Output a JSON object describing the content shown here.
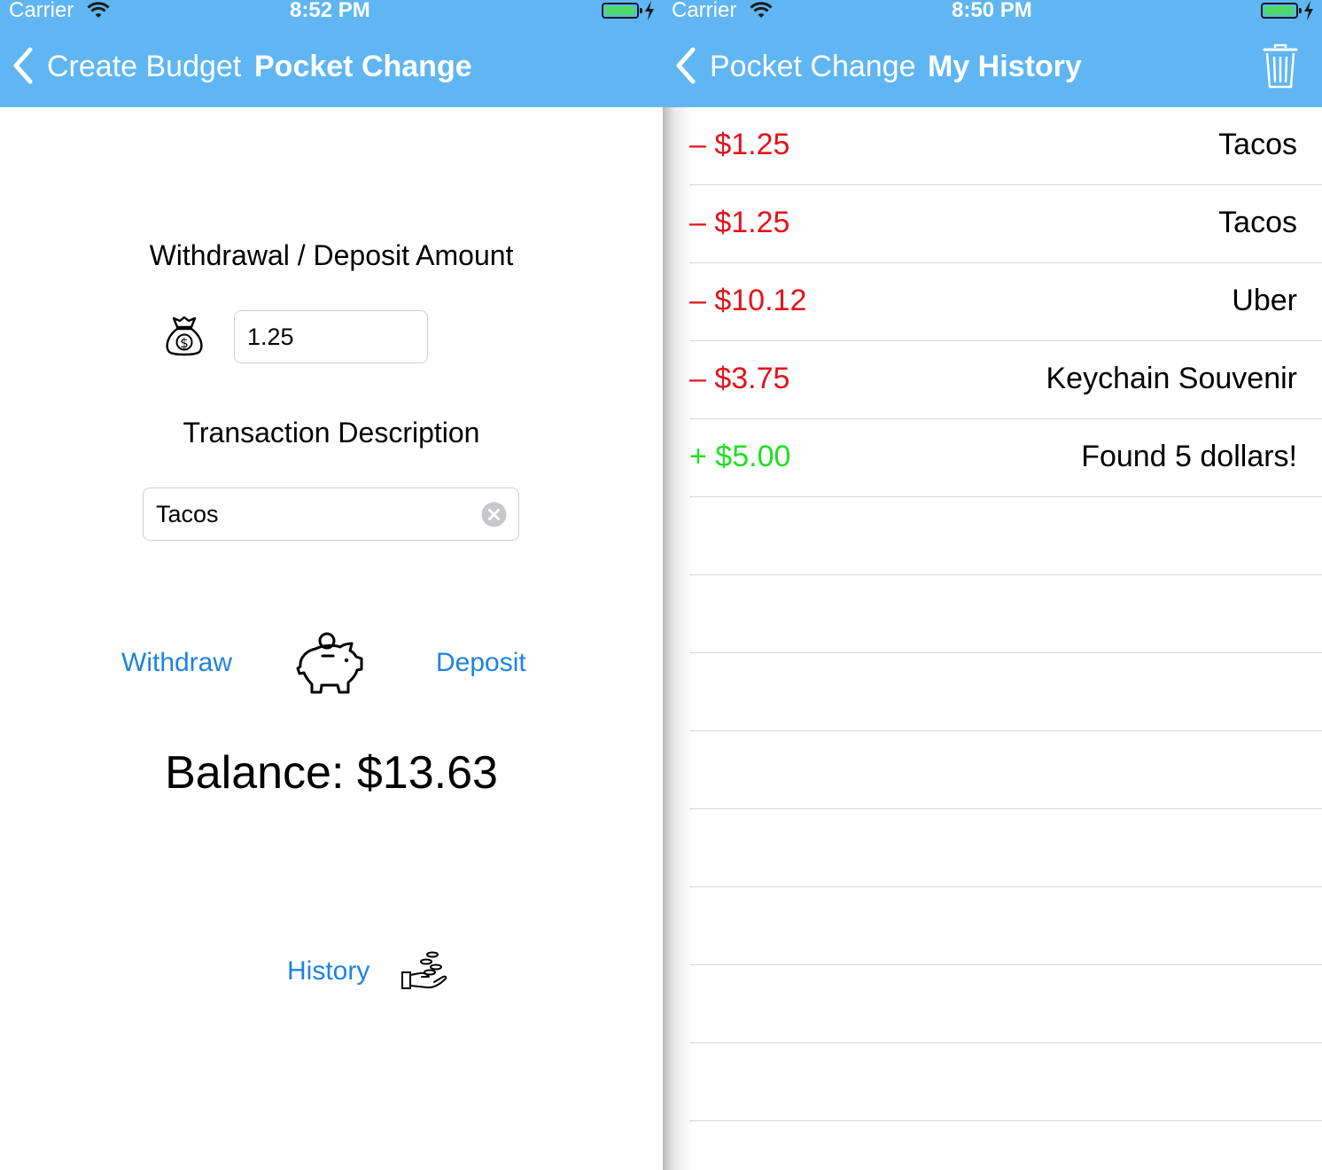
{
  "left": {
    "status": {
      "carrier": "Carrier",
      "time": "8:52 PM"
    },
    "nav": {
      "back_label": "Create Budget",
      "title": "Pocket Change"
    },
    "amount_label": "Withdrawal / Deposit Amount",
    "amount_value": "1.25",
    "description_label": "Transaction Description",
    "description_value": "Tacos",
    "withdraw_label": "Withdraw",
    "deposit_label": "Deposit",
    "balance": "Balance: $13.63",
    "history_label": "History",
    "icons": {
      "amount": "money-bag-icon",
      "center": "piggy-bank-icon",
      "history": "hand-coins-icon",
      "clear": "clear-circle-icon"
    }
  },
  "right": {
    "status": {
      "carrier": "Carrier",
      "time": "8:50 PM"
    },
    "nav": {
      "back_label": "Pocket Change",
      "title": "My History",
      "action_icon": "trash-icon"
    },
    "transactions": [
      {
        "amount": "– $1.25",
        "description": "Tacos",
        "type": "withdrawal"
      },
      {
        "amount": "– $1.25",
        "description": "Tacos",
        "type": "withdrawal"
      },
      {
        "amount": "– $10.12",
        "description": "Uber",
        "type": "withdrawal"
      },
      {
        "amount": "– $3.75",
        "description": "Keychain Souvenir",
        "type": "withdrawal"
      },
      {
        "amount": "+ $5.00",
        "description": "Found 5 dollars!",
        "type": "deposit"
      }
    ]
  },
  "colors": {
    "nav_background": "#5fb6f2",
    "link": "#1d82e4",
    "withdrawal": "#e4131b",
    "deposit": "#1fe01f",
    "battery": "#4cd964"
  }
}
